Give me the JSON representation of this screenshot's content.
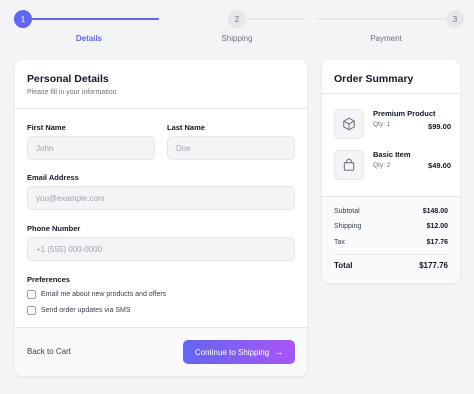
{
  "stepper": {
    "steps": [
      {
        "number": "1",
        "label": "Details",
        "active": true
      },
      {
        "number": "2",
        "label": "Shipping",
        "active": false
      },
      {
        "number": "3",
        "label": "Payment",
        "active": false
      }
    ]
  },
  "personal": {
    "title": "Personal Details",
    "subtitle": "Please fill in your information",
    "first_name": {
      "label": "First Name",
      "placeholder": "John",
      "value": ""
    },
    "last_name": {
      "label": "Last Name",
      "placeholder": "Doe",
      "value": ""
    },
    "email": {
      "label": "Email Address",
      "placeholder": "you@example.com",
      "value": ""
    },
    "phone": {
      "label": "Phone Number",
      "placeholder": "+1 (555) 000-0000",
      "value": ""
    },
    "preferences": {
      "label": "Preferences",
      "options": [
        {
          "label": "Email me about new products and offers",
          "checked": false
        },
        {
          "label": "Send order updates via SMS",
          "checked": false
        }
      ]
    },
    "back_label": "Back to Cart",
    "continue_label": "Continue to Shipping",
    "continue_icon": "arrow-right-icon"
  },
  "summary": {
    "title": "Order Summary",
    "items": [
      {
        "name": "Premium Product",
        "qty": "Qty: 1",
        "price": "$99.00",
        "icon": "box-icon"
      },
      {
        "name": "Basic Item",
        "qty": "Qty: 2",
        "price": "$49.00",
        "icon": "bag-icon"
      }
    ],
    "subtotal_label": "Subtotal",
    "subtotal": "$148.00",
    "shipping_label": "Shipping",
    "shipping": "$12.00",
    "tax_label": "Tax",
    "tax": "$17.76",
    "total_label": "Total",
    "total": "$177.76"
  },
  "colors": {
    "accent": "#6366f1",
    "gradient_end": "#a855f7",
    "background": "#f3f4f6"
  }
}
